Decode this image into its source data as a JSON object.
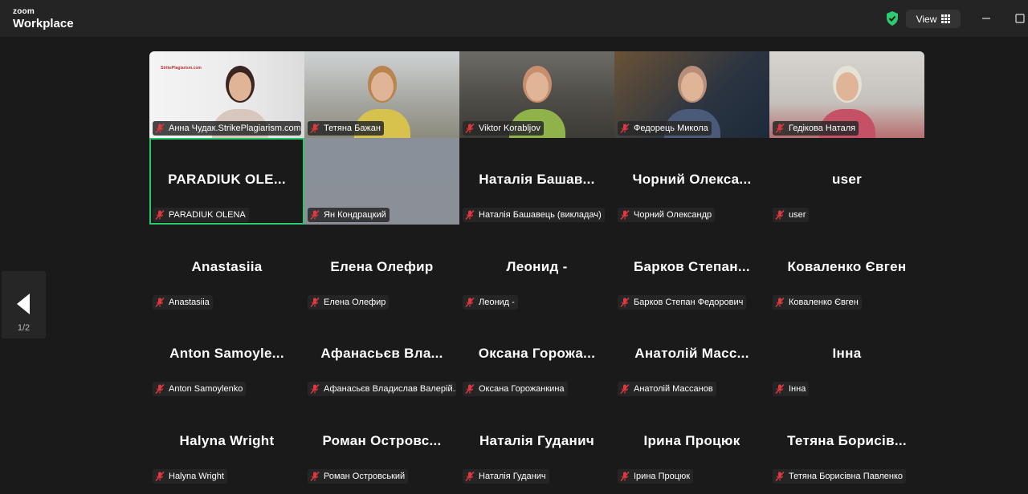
{
  "app": {
    "logo_line1": "zoom",
    "logo_line2": "Workplace",
    "view_label": "View",
    "page_indicator": "1/2"
  },
  "tiles": [
    {
      "big": "",
      "name": "Анна Чудак.StrikePlagiarism.com",
      "video": true
    },
    {
      "big": "",
      "name": "Тетяна Бажан",
      "video": true
    },
    {
      "big": "",
      "name": "Viktor Korabljov",
      "video": true
    },
    {
      "big": "",
      "name": "Федорець Микола",
      "video": true
    },
    {
      "big": "",
      "name": "Гедікова Наталя",
      "video": true
    },
    {
      "big": "PARADIUK OLE...",
      "name": "PARADIUK OLENA",
      "active": true
    },
    {
      "big": "",
      "name": "Ян Кондрацкий",
      "video": true,
      "blank": true
    },
    {
      "big": "Наталія Башав...",
      "name": "Наталія Башавець (викладач)"
    },
    {
      "big": "Чорний Олекса...",
      "name": "Чорний Олександр"
    },
    {
      "big": "user",
      "name": "user"
    },
    {
      "big": "Anastasiia",
      "name": "Anastasiia"
    },
    {
      "big": "Елена Олефир",
      "name": "Елена Олефир"
    },
    {
      "big": "Леонид -",
      "name": "Леонид -"
    },
    {
      "big": "Барков Степан...",
      "name": "Барков Степан Федорович"
    },
    {
      "big": "Коваленко Євген",
      "name": "Коваленко Євген"
    },
    {
      "big": "Anton Samoyle...",
      "name": "Anton Samoylenko"
    },
    {
      "big": "Афанасьєв Вла...",
      "name": "Афанасьєв Владислав Валерій..."
    },
    {
      "big": "Оксана Горожа...",
      "name": "Оксана Горожанкина"
    },
    {
      "big": "Анатолій Масс...",
      "name": "Анатолій Массанов"
    },
    {
      "big": "Інна",
      "name": "Інна"
    },
    {
      "big": "Halyna Wright",
      "name": "Halyna Wright"
    },
    {
      "big": "Роман Островс...",
      "name": "Роман Островський"
    },
    {
      "big": "Наталія Гуданич",
      "name": "Наталія Гуданич"
    },
    {
      "big": "Ірина Процюк",
      "name": "Ірина Процюк"
    },
    {
      "big": "Тетяна Борисів...",
      "name": "Тетяна Борисівна Павленко"
    }
  ],
  "colors": {
    "active_border": "#29c96b",
    "muted_mic": "#e0383e",
    "shield": "#2ecc71"
  },
  "video_thumb": {
    "logo_text": "StrikePlagiarism.com"
  }
}
